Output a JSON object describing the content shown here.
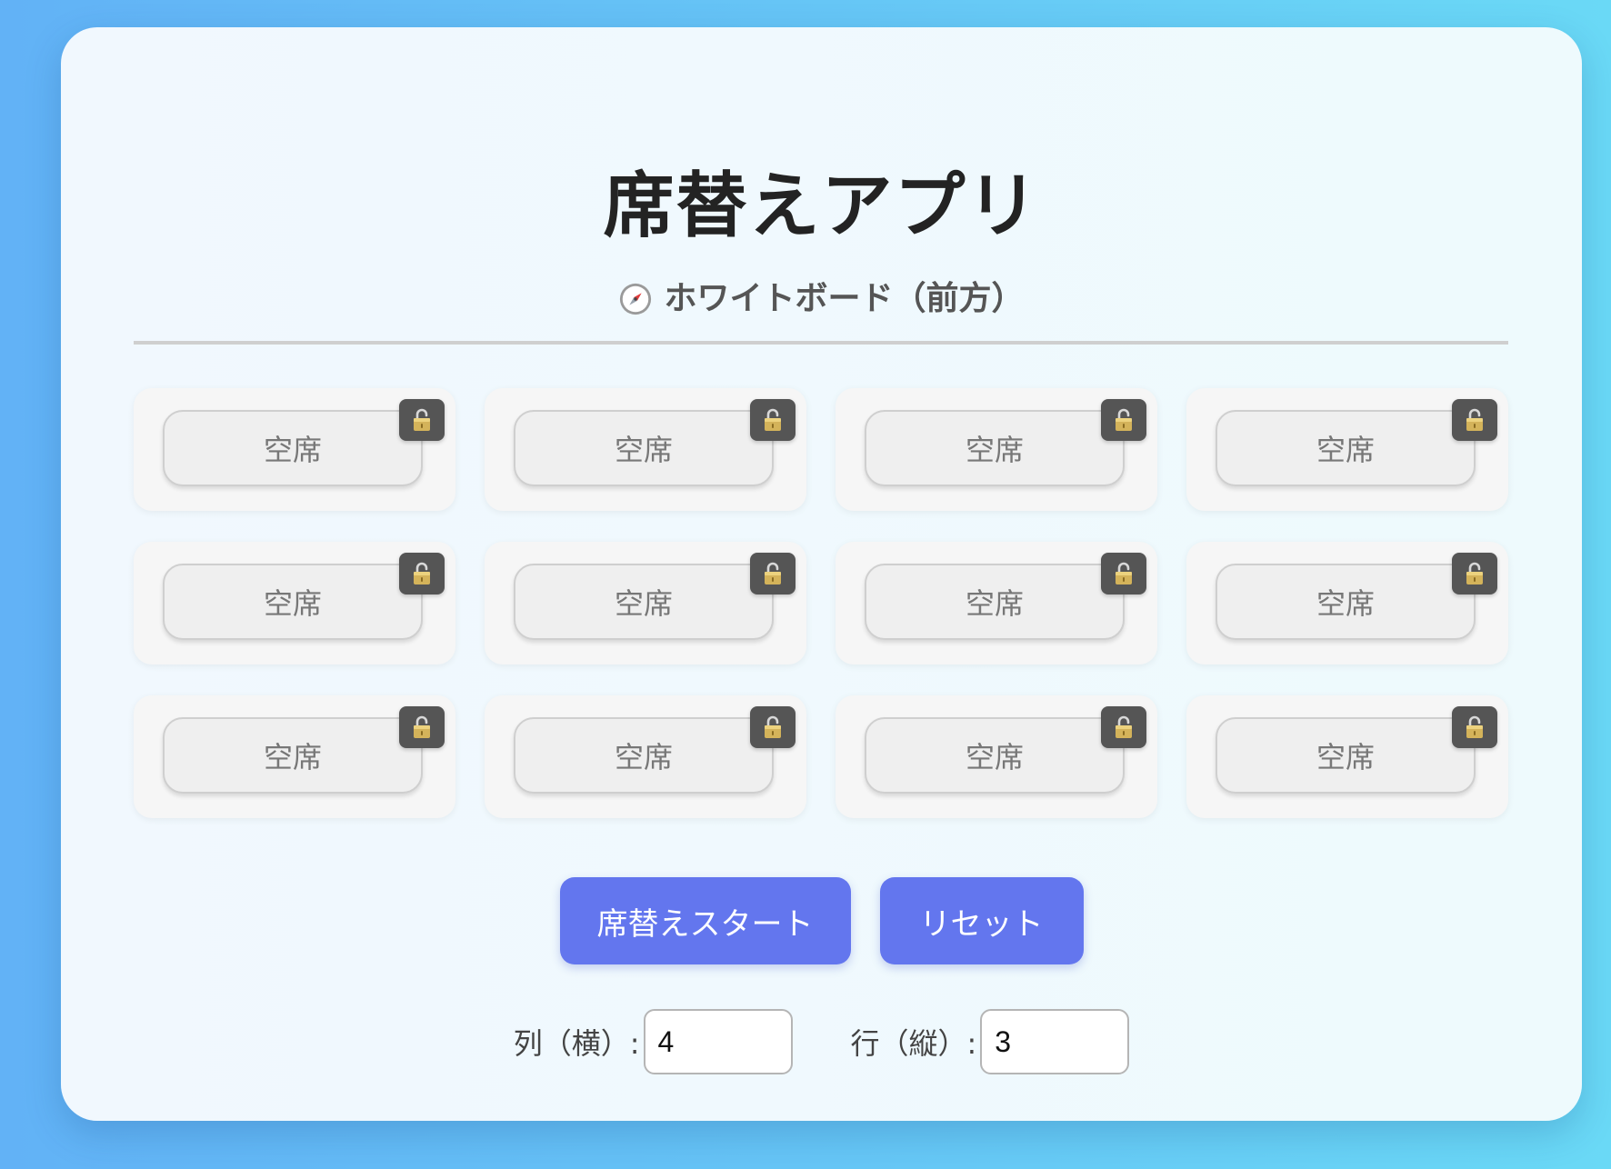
{
  "app": {
    "title": "席替えアプリ",
    "board_label": "ホワイトボード（前方）",
    "board_icon": "compass-icon"
  },
  "grid": {
    "columns": 4,
    "rows": 3,
    "seats": [
      {
        "label": "空席",
        "locked": false
      },
      {
        "label": "空席",
        "locked": false
      },
      {
        "label": "空席",
        "locked": false
      },
      {
        "label": "空席",
        "locked": false
      },
      {
        "label": "空席",
        "locked": false
      },
      {
        "label": "空席",
        "locked": false
      },
      {
        "label": "空席",
        "locked": false
      },
      {
        "label": "空席",
        "locked": false
      },
      {
        "label": "空席",
        "locked": false
      },
      {
        "label": "空席",
        "locked": false
      },
      {
        "label": "空席",
        "locked": false
      },
      {
        "label": "空席",
        "locked": false
      }
    ],
    "lock_icon": "unlocked-padlock-icon"
  },
  "actions": {
    "start_label": "席替えスタート",
    "reset_label": "リセット"
  },
  "settings": {
    "columns_label": "列（横）:",
    "columns_value": "4",
    "rows_label": "行（縦）:",
    "rows_value": "3"
  },
  "colors": {
    "accent": "#6376ee",
    "background_start": "#62b2f6",
    "background_end": "#6ad9f6",
    "lock_button": "#555555"
  }
}
